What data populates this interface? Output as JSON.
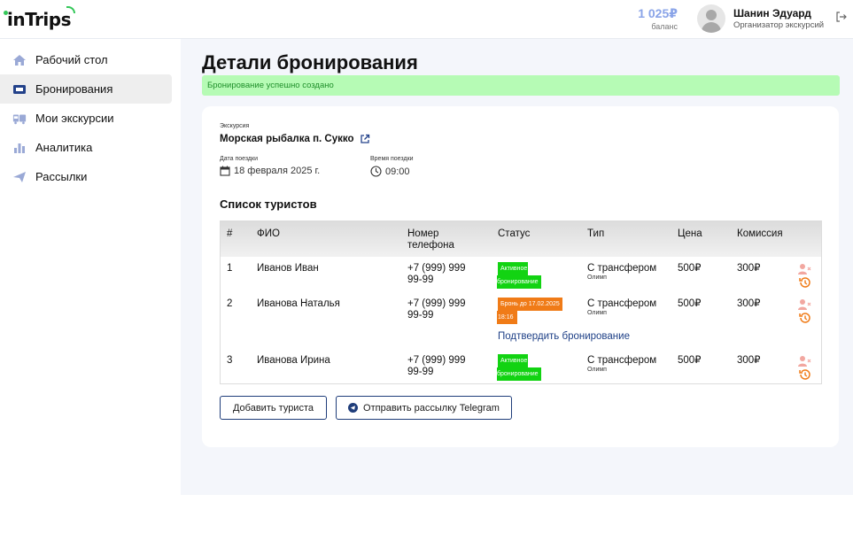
{
  "header": {
    "logo": "inTrips",
    "balance_amount": "1 025₽",
    "balance_label": "баланс",
    "user_name": "Шанин Эдуард",
    "user_role": "Организатор экскурсий"
  },
  "sidebar": {
    "items": [
      {
        "label": "Рабочий стол",
        "icon": "home-icon"
      },
      {
        "label": "Бронирования",
        "icon": "ticket-icon"
      },
      {
        "label": "Мои экскурсии",
        "icon": "bus-icon"
      },
      {
        "label": "Аналитика",
        "icon": "bar-chart-icon"
      },
      {
        "label": "Рассылки",
        "icon": "send-icon"
      }
    ],
    "active_index": 1
  },
  "page": {
    "title": "Детали бронирования",
    "alert": "Бронирование успешно создано"
  },
  "booking": {
    "excursion_label": "Экскурсия",
    "excursion_name": "Морская рыбалка п. Сукко",
    "date_label": "Дата поездки",
    "date_value": "18 февраля 2025 г.",
    "time_label": "Время поездки",
    "time_value": "09:00"
  },
  "tourists": {
    "title": "Список туристов",
    "columns": {
      "num": "#",
      "name": "ФИО",
      "phone_line1": "Номер",
      "phone_line2": "телефона",
      "status": "Статус",
      "type": "Тип",
      "price": "Цена",
      "commission": "Комиссия"
    },
    "rows": [
      {
        "num": "1",
        "name": "Иванов Иван",
        "phone_line1": "+7 (999) 999",
        "phone_line2": "99-99",
        "status_line1": "Активное",
        "status_line2": "бронирование",
        "type": "С трансфером",
        "type_sub": "Олимп",
        "price": "500₽",
        "commission": "300₽"
      },
      {
        "num": "2",
        "name": "Иванова Наталья",
        "phone_line1": "+7 (999) 999",
        "phone_line2": "99-99",
        "status_line1": "Бронь до 17.02.2025",
        "status_line2": "18:16",
        "type": "С трансфером",
        "type_sub": "Олимп",
        "price": "500₽",
        "commission": "300₽",
        "action": "Подтвердить бронирование"
      },
      {
        "num": "3",
        "name": "Иванова Ирина",
        "phone_line1": "+7 (999) 999",
        "phone_line2": "99-99",
        "status_line1": "Активное",
        "status_line2": "бронирование",
        "type": "С трансфером",
        "type_sub": "Олимп",
        "price": "500₽",
        "commission": "300₽"
      }
    ]
  },
  "buttons": {
    "add_tourist": "Добавить туриста",
    "send_telegram": "Отправить рассылку Telegram"
  },
  "colors": {
    "accent": "#1f3d7a",
    "status_active": "#12d312",
    "status_pending": "#f07b17",
    "alert_bg": "#b6fbb5",
    "balance": "#8aa4e8"
  }
}
